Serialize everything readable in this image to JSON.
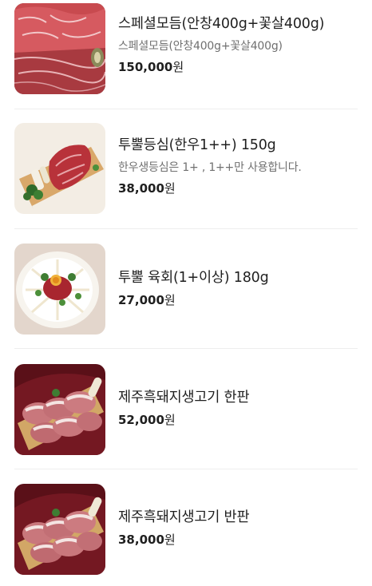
{
  "menu": {
    "items": [
      {
        "name": "스페셜모듬(안창400g+꽃살400g)",
        "description": "스페셜모듬(안창400g+꽃살400g)",
        "price": "150,000",
        "currency": "원",
        "image_icon": "marbled-beef-platter-icon"
      },
      {
        "name": "투뿔등심(한우1++) 150g",
        "description": "한우생등심은 1+ , 1++만 사용합니다.",
        "price": "38,000",
        "currency": "원",
        "image_icon": "sirloin-on-board-icon"
      },
      {
        "name": "투뿔 육회(1+이상) 180g",
        "description": "",
        "price": "27,000",
        "currency": "원",
        "image_icon": "beef-tartare-plate-icon"
      },
      {
        "name": "제주흑돼지생고기 한판",
        "description": "",
        "price": "52,000",
        "currency": "원",
        "image_icon": "black-pork-platter-icon"
      },
      {
        "name": "제주흑돼지생고기 반판",
        "description": "",
        "price": "38,000",
        "currency": "원",
        "image_icon": "black-pork-half-platter-icon"
      }
    ]
  }
}
